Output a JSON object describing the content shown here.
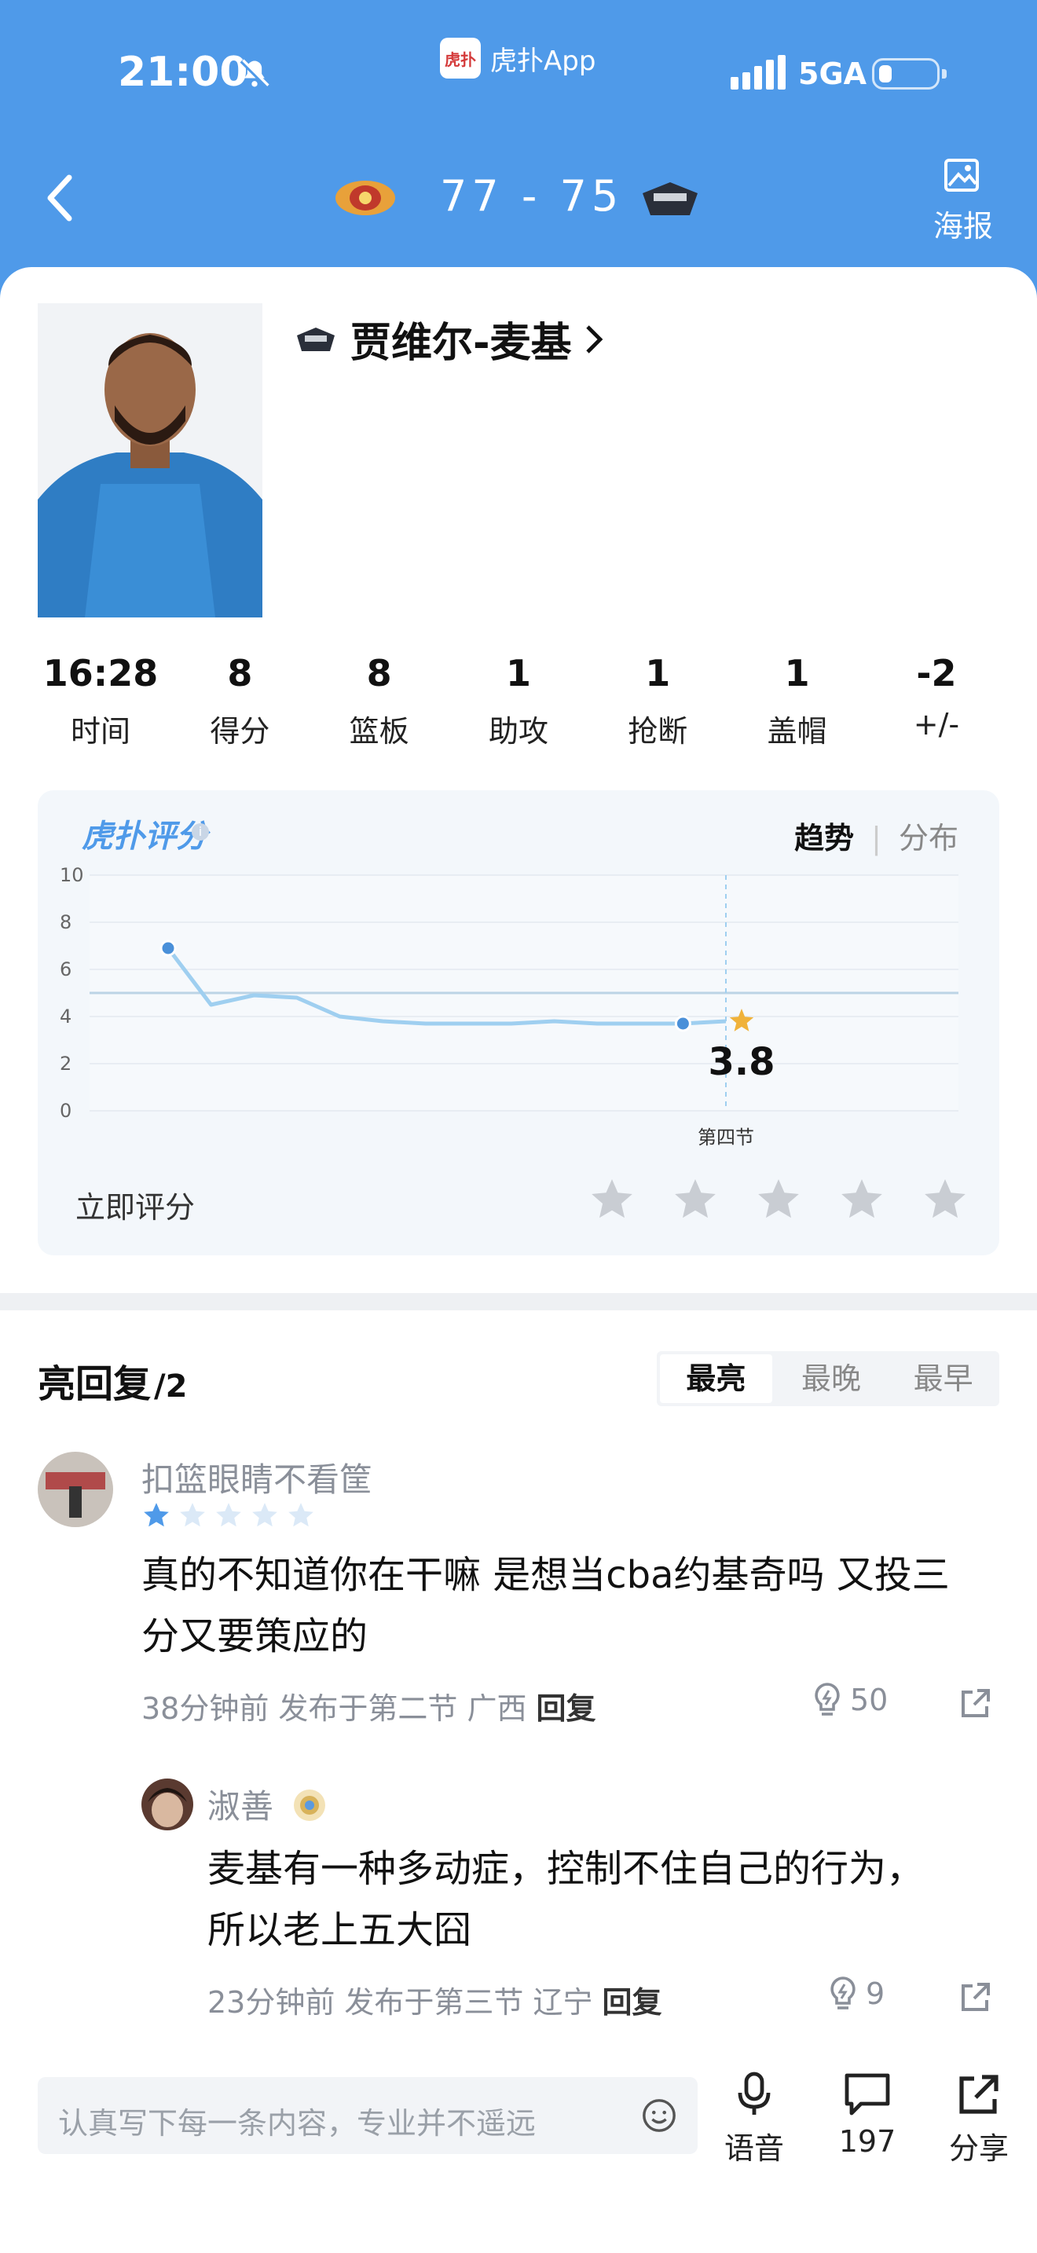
{
  "status_bar": {
    "time": "21:00",
    "app_name": "虎扑App",
    "app_logo_text": "虎扑",
    "network": "5GA"
  },
  "header": {
    "score": "77 - 75",
    "poster_label": "海报",
    "accent_color": "#4f9ae9"
  },
  "player": {
    "name": "贾维尔-麦基",
    "stats": [
      {
        "value": "16:28",
        "label": "时间"
      },
      {
        "value": "8",
        "label": "得分"
      },
      {
        "value": "8",
        "label": "篮板"
      },
      {
        "value": "1",
        "label": "助攻"
      },
      {
        "value": "1",
        "label": "抢断"
      },
      {
        "value": "1",
        "label": "盖帽"
      },
      {
        "value": "-2",
        "label": "+/-"
      }
    ]
  },
  "rating": {
    "logo_text": "虎扑评分",
    "tabs": {
      "trend": "趋势",
      "distribution": "分布"
    },
    "current_value": "3.8",
    "period_label": "第四节",
    "rate_now_label": "立即评分",
    "star_count": 5
  },
  "chart_data": {
    "type": "line",
    "ylim": [
      0,
      10
    ],
    "yticks": [
      "0",
      "2",
      "4",
      "6",
      "8",
      "10"
    ],
    "x_labels": [
      "第四节"
    ],
    "reference_line": 5,
    "series": [
      {
        "values": [
          6.9,
          4.5,
          4.9,
          4.8,
          4.0,
          3.8,
          3.7,
          3.7,
          3.7,
          3.8,
          3.7,
          3.7,
          3.7,
          3.8
        ]
      }
    ]
  },
  "comments": {
    "title": "亮回复",
    "count": "/2",
    "sort": {
      "best": "最亮",
      "latest": "最晚",
      "earliest": "最早"
    },
    "items": [
      {
        "user": "扣篮眼睛不看筐",
        "rating": 1,
        "text": "真的不知道你在干嘛 是想当cba约基奇吗 又投三分又要策应的",
        "meta": "38分钟前 发布于第二节 广西",
        "reply": "回复",
        "likes": "50"
      },
      {
        "user": "淑善",
        "text": "麦基有一种多动症，控制不住自己的行为，所以老上五大囧",
        "meta": "23分钟前 发布于第三节 辽宁",
        "reply": "回复",
        "likes": "9"
      }
    ]
  },
  "bottom_bar": {
    "input_placeholder": "认真写下每一条内容，专业并不遥远",
    "voice_label": "语音",
    "comment_count": "197",
    "share_label": "分享"
  }
}
